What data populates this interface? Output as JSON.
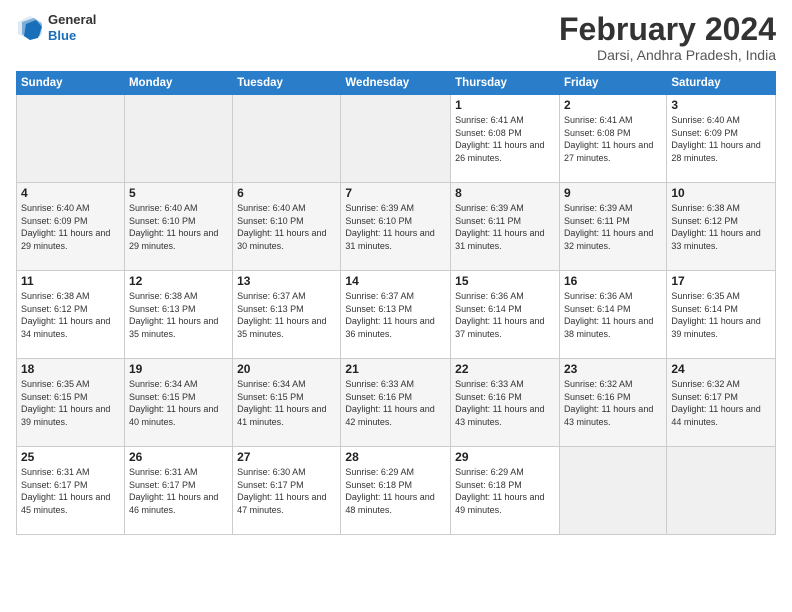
{
  "header": {
    "logo_general": "General",
    "logo_blue": "Blue",
    "month_year": "February 2024",
    "location": "Darsi, Andhra Pradesh, India"
  },
  "days_of_week": [
    "Sunday",
    "Monday",
    "Tuesday",
    "Wednesday",
    "Thursday",
    "Friday",
    "Saturday"
  ],
  "weeks": [
    [
      {
        "day": "",
        "info": ""
      },
      {
        "day": "",
        "info": ""
      },
      {
        "day": "",
        "info": ""
      },
      {
        "day": "",
        "info": ""
      },
      {
        "day": "1",
        "info": "Sunrise: 6:41 AM\nSunset: 6:08 PM\nDaylight: 11 hours and 26 minutes."
      },
      {
        "day": "2",
        "info": "Sunrise: 6:41 AM\nSunset: 6:08 PM\nDaylight: 11 hours and 27 minutes."
      },
      {
        "day": "3",
        "info": "Sunrise: 6:40 AM\nSunset: 6:09 PM\nDaylight: 11 hours and 28 minutes."
      }
    ],
    [
      {
        "day": "4",
        "info": "Sunrise: 6:40 AM\nSunset: 6:09 PM\nDaylight: 11 hours and 29 minutes."
      },
      {
        "day": "5",
        "info": "Sunrise: 6:40 AM\nSunset: 6:10 PM\nDaylight: 11 hours and 29 minutes."
      },
      {
        "day": "6",
        "info": "Sunrise: 6:40 AM\nSunset: 6:10 PM\nDaylight: 11 hours and 30 minutes."
      },
      {
        "day": "7",
        "info": "Sunrise: 6:39 AM\nSunset: 6:10 PM\nDaylight: 11 hours and 31 minutes."
      },
      {
        "day": "8",
        "info": "Sunrise: 6:39 AM\nSunset: 6:11 PM\nDaylight: 11 hours and 31 minutes."
      },
      {
        "day": "9",
        "info": "Sunrise: 6:39 AM\nSunset: 6:11 PM\nDaylight: 11 hours and 32 minutes."
      },
      {
        "day": "10",
        "info": "Sunrise: 6:38 AM\nSunset: 6:12 PM\nDaylight: 11 hours and 33 minutes."
      }
    ],
    [
      {
        "day": "11",
        "info": "Sunrise: 6:38 AM\nSunset: 6:12 PM\nDaylight: 11 hours and 34 minutes."
      },
      {
        "day": "12",
        "info": "Sunrise: 6:38 AM\nSunset: 6:13 PM\nDaylight: 11 hours and 35 minutes."
      },
      {
        "day": "13",
        "info": "Sunrise: 6:37 AM\nSunset: 6:13 PM\nDaylight: 11 hours and 35 minutes."
      },
      {
        "day": "14",
        "info": "Sunrise: 6:37 AM\nSunset: 6:13 PM\nDaylight: 11 hours and 36 minutes."
      },
      {
        "day": "15",
        "info": "Sunrise: 6:36 AM\nSunset: 6:14 PM\nDaylight: 11 hours and 37 minutes."
      },
      {
        "day": "16",
        "info": "Sunrise: 6:36 AM\nSunset: 6:14 PM\nDaylight: 11 hours and 38 minutes."
      },
      {
        "day": "17",
        "info": "Sunrise: 6:35 AM\nSunset: 6:14 PM\nDaylight: 11 hours and 39 minutes."
      }
    ],
    [
      {
        "day": "18",
        "info": "Sunrise: 6:35 AM\nSunset: 6:15 PM\nDaylight: 11 hours and 39 minutes."
      },
      {
        "day": "19",
        "info": "Sunrise: 6:34 AM\nSunset: 6:15 PM\nDaylight: 11 hours and 40 minutes."
      },
      {
        "day": "20",
        "info": "Sunrise: 6:34 AM\nSunset: 6:15 PM\nDaylight: 11 hours and 41 minutes."
      },
      {
        "day": "21",
        "info": "Sunrise: 6:33 AM\nSunset: 6:16 PM\nDaylight: 11 hours and 42 minutes."
      },
      {
        "day": "22",
        "info": "Sunrise: 6:33 AM\nSunset: 6:16 PM\nDaylight: 11 hours and 43 minutes."
      },
      {
        "day": "23",
        "info": "Sunrise: 6:32 AM\nSunset: 6:16 PM\nDaylight: 11 hours and 43 minutes."
      },
      {
        "day": "24",
        "info": "Sunrise: 6:32 AM\nSunset: 6:17 PM\nDaylight: 11 hours and 44 minutes."
      }
    ],
    [
      {
        "day": "25",
        "info": "Sunrise: 6:31 AM\nSunset: 6:17 PM\nDaylight: 11 hours and 45 minutes."
      },
      {
        "day": "26",
        "info": "Sunrise: 6:31 AM\nSunset: 6:17 PM\nDaylight: 11 hours and 46 minutes."
      },
      {
        "day": "27",
        "info": "Sunrise: 6:30 AM\nSunset: 6:17 PM\nDaylight: 11 hours and 47 minutes."
      },
      {
        "day": "28",
        "info": "Sunrise: 6:29 AM\nSunset: 6:18 PM\nDaylight: 11 hours and 48 minutes."
      },
      {
        "day": "29",
        "info": "Sunrise: 6:29 AM\nSunset: 6:18 PM\nDaylight: 11 hours and 49 minutes."
      },
      {
        "day": "",
        "info": ""
      },
      {
        "day": "",
        "info": ""
      }
    ]
  ]
}
